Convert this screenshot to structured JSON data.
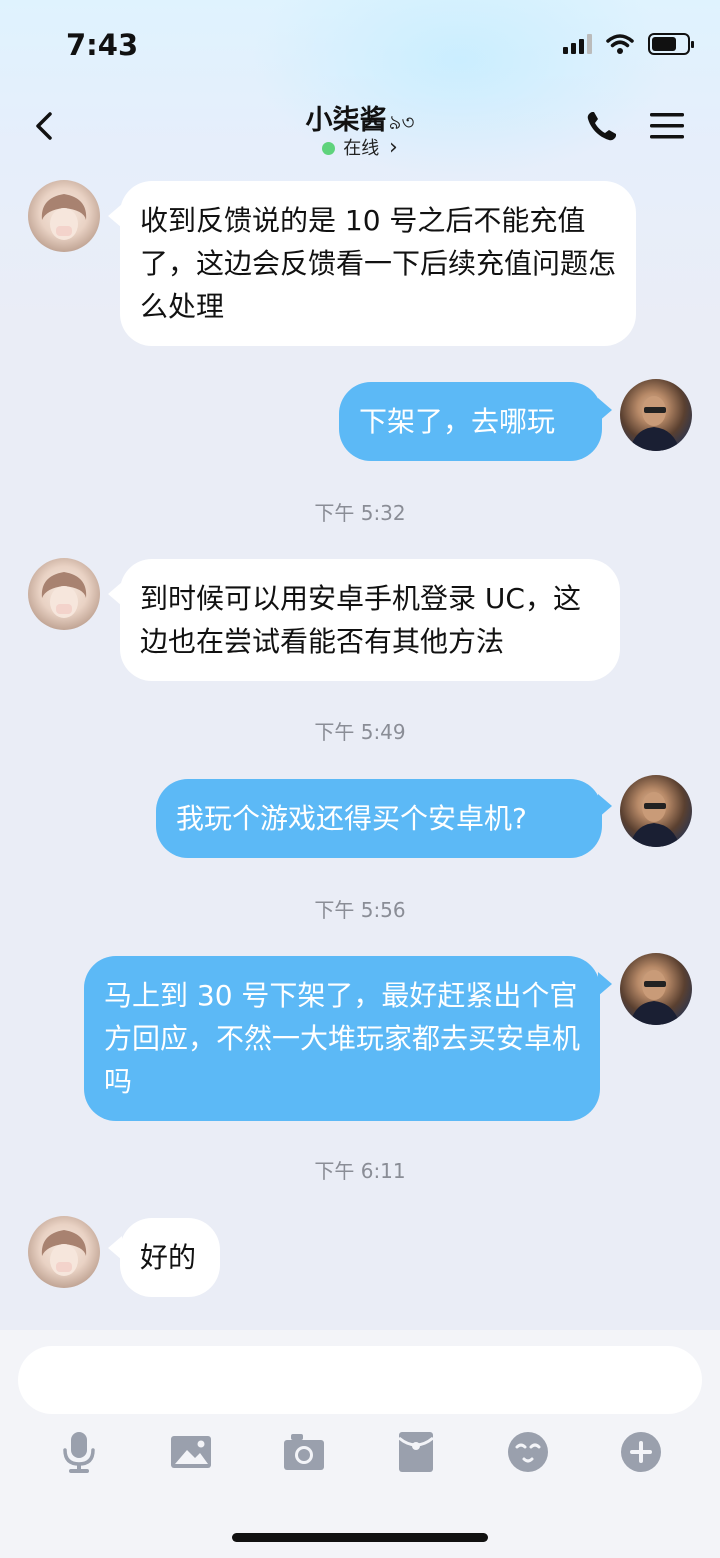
{
  "status_bar": {
    "time": "7:43"
  },
  "nav": {
    "title": "小柒酱",
    "title_decoration": "৯৩",
    "status": "在线",
    "status_chevron": "›"
  },
  "messages": [
    {
      "side": "left",
      "text": "收到反馈说的是 10 号之后不能充值了，这边会反馈看一下后续充值问题怎么处理"
    },
    {
      "side": "right",
      "text": "下架了，去哪玩"
    },
    {
      "type": "timestamp",
      "text": "下午 5:32"
    },
    {
      "side": "left",
      "text": "到时候可以用安卓手机登录 UC，这边也在尝试看能否有其他方法"
    },
    {
      "type": "timestamp",
      "text": "下午 5:49"
    },
    {
      "side": "right",
      "text": "我玩个游戏还得买个安卓机?"
    },
    {
      "type": "timestamp",
      "text": "下午 5:56"
    },
    {
      "side": "right",
      "text": "马上到 30 号下架了，最好赶紧出个官方回应，不然一大堆玩家都去买安卓机吗"
    },
    {
      "type": "timestamp",
      "text": "下午 6:11"
    },
    {
      "side": "left",
      "text": "好的"
    }
  ],
  "input": {
    "placeholder": ""
  },
  "toolbar": {
    "icons": [
      "microphone-icon",
      "image-icon",
      "camera-icon",
      "red-packet-icon",
      "emoji-icon",
      "plus-icon"
    ]
  },
  "colors": {
    "my_bubble": "#5cb9f6",
    "their_bubble": "#ffffff",
    "online": "#5fd37c",
    "background": "#eaedf6"
  }
}
